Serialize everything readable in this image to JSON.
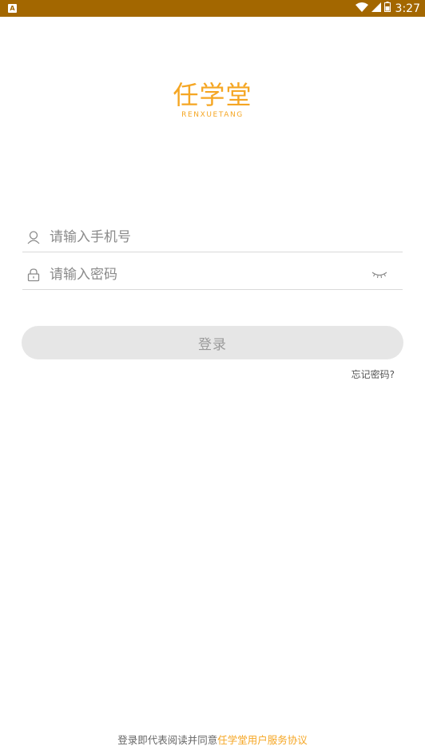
{
  "status_bar": {
    "app_icon": "A",
    "time": "3:27",
    "icons": [
      "wifi-icon",
      "cell-signal-icon",
      "battery-icon"
    ]
  },
  "logo": {
    "title_cn": "任学堂",
    "title_en": "RENXUETANG"
  },
  "form": {
    "phone_placeholder": "请输入手机号",
    "phone_value": "",
    "password_placeholder": "请输入密码",
    "password_value": "",
    "login_label": "登录",
    "forgot_label": "忘记密码?"
  },
  "footer": {
    "agreement_prefix": "登录即代表阅读并同意",
    "agreement_link": "任学堂用户服务协议"
  },
  "colors": {
    "status_bar": "#a36700",
    "brand": "#f5a623",
    "button_bg": "#e6e6e6",
    "button_text": "#9a9a9a"
  }
}
